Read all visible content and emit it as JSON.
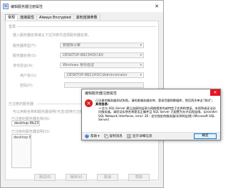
{
  "window": {
    "title": "编辑服务器注册属性",
    "close_glyph": "✕"
  },
  "tabs": [
    "常规",
    "连接属性",
    "Always Encrypted",
    "其他连接参数"
  ],
  "form": {
    "login_heading": "登录",
    "login_hint": "键入服务器名称或从下拉列表中选择服务器名称。",
    "server_type_label": "服务器类型(T):",
    "server_type_value": "数据库引擎",
    "server_name_label": "服务器名称(S):",
    "server_name_value": "DESKTOP-8B23HDC\\KV",
    "auth_label": "身份验证(A):",
    "auth_value": "Windows 身份验证",
    "username_label": "用户名(U):",
    "username_value": "DESKTOP-8B21HDC\\Administrator",
    "password_label": "密码(P):",
    "registered_heading": "已注册的服务器",
    "registered_hint": "可以用新名称和服务器说明(可选)替换已注册的服务器名称。",
    "reg_name_label": "已注册的服务器名称(N):",
    "reg_name_value": "desktop-8b23hdc\\kv",
    "reg_desc_label": "已注册的服务器说明(D):",
    "list_item": "desktop-8b23hdc\\kv"
  },
  "buttons": {
    "test": "测试(E)",
    "save": "保存(V)",
    "cancel": "取消",
    "help": "帮助"
  },
  "dialog": {
    "title": "编辑服务器注册属性",
    "close_glyph": "✕",
    "line1": "已注册的服务器测试失败。请检查服务器名称、登录凭据和数据库，然后再次单击\"测试\"。",
    "extra_heading": "其他信息:",
    "bullet": "→ 在与 SQL Server 建立连接时出现与网络相关的或特定于实例的错误。未找到或无法访问服务器。请验证实例名称是否正确并且 SQL Server 已配置为允许远程连接。(provider: SQL Network Interfaces, error: 26 - 定位指定的服务器/实例时出错) (Microsoft SQL Server)",
    "footer_help": "帮助",
    "footer_copy": "复制消息",
    "footer_details": "显示详细信息",
    "ok_label": "确定",
    "icon_glyph": "✕"
  }
}
